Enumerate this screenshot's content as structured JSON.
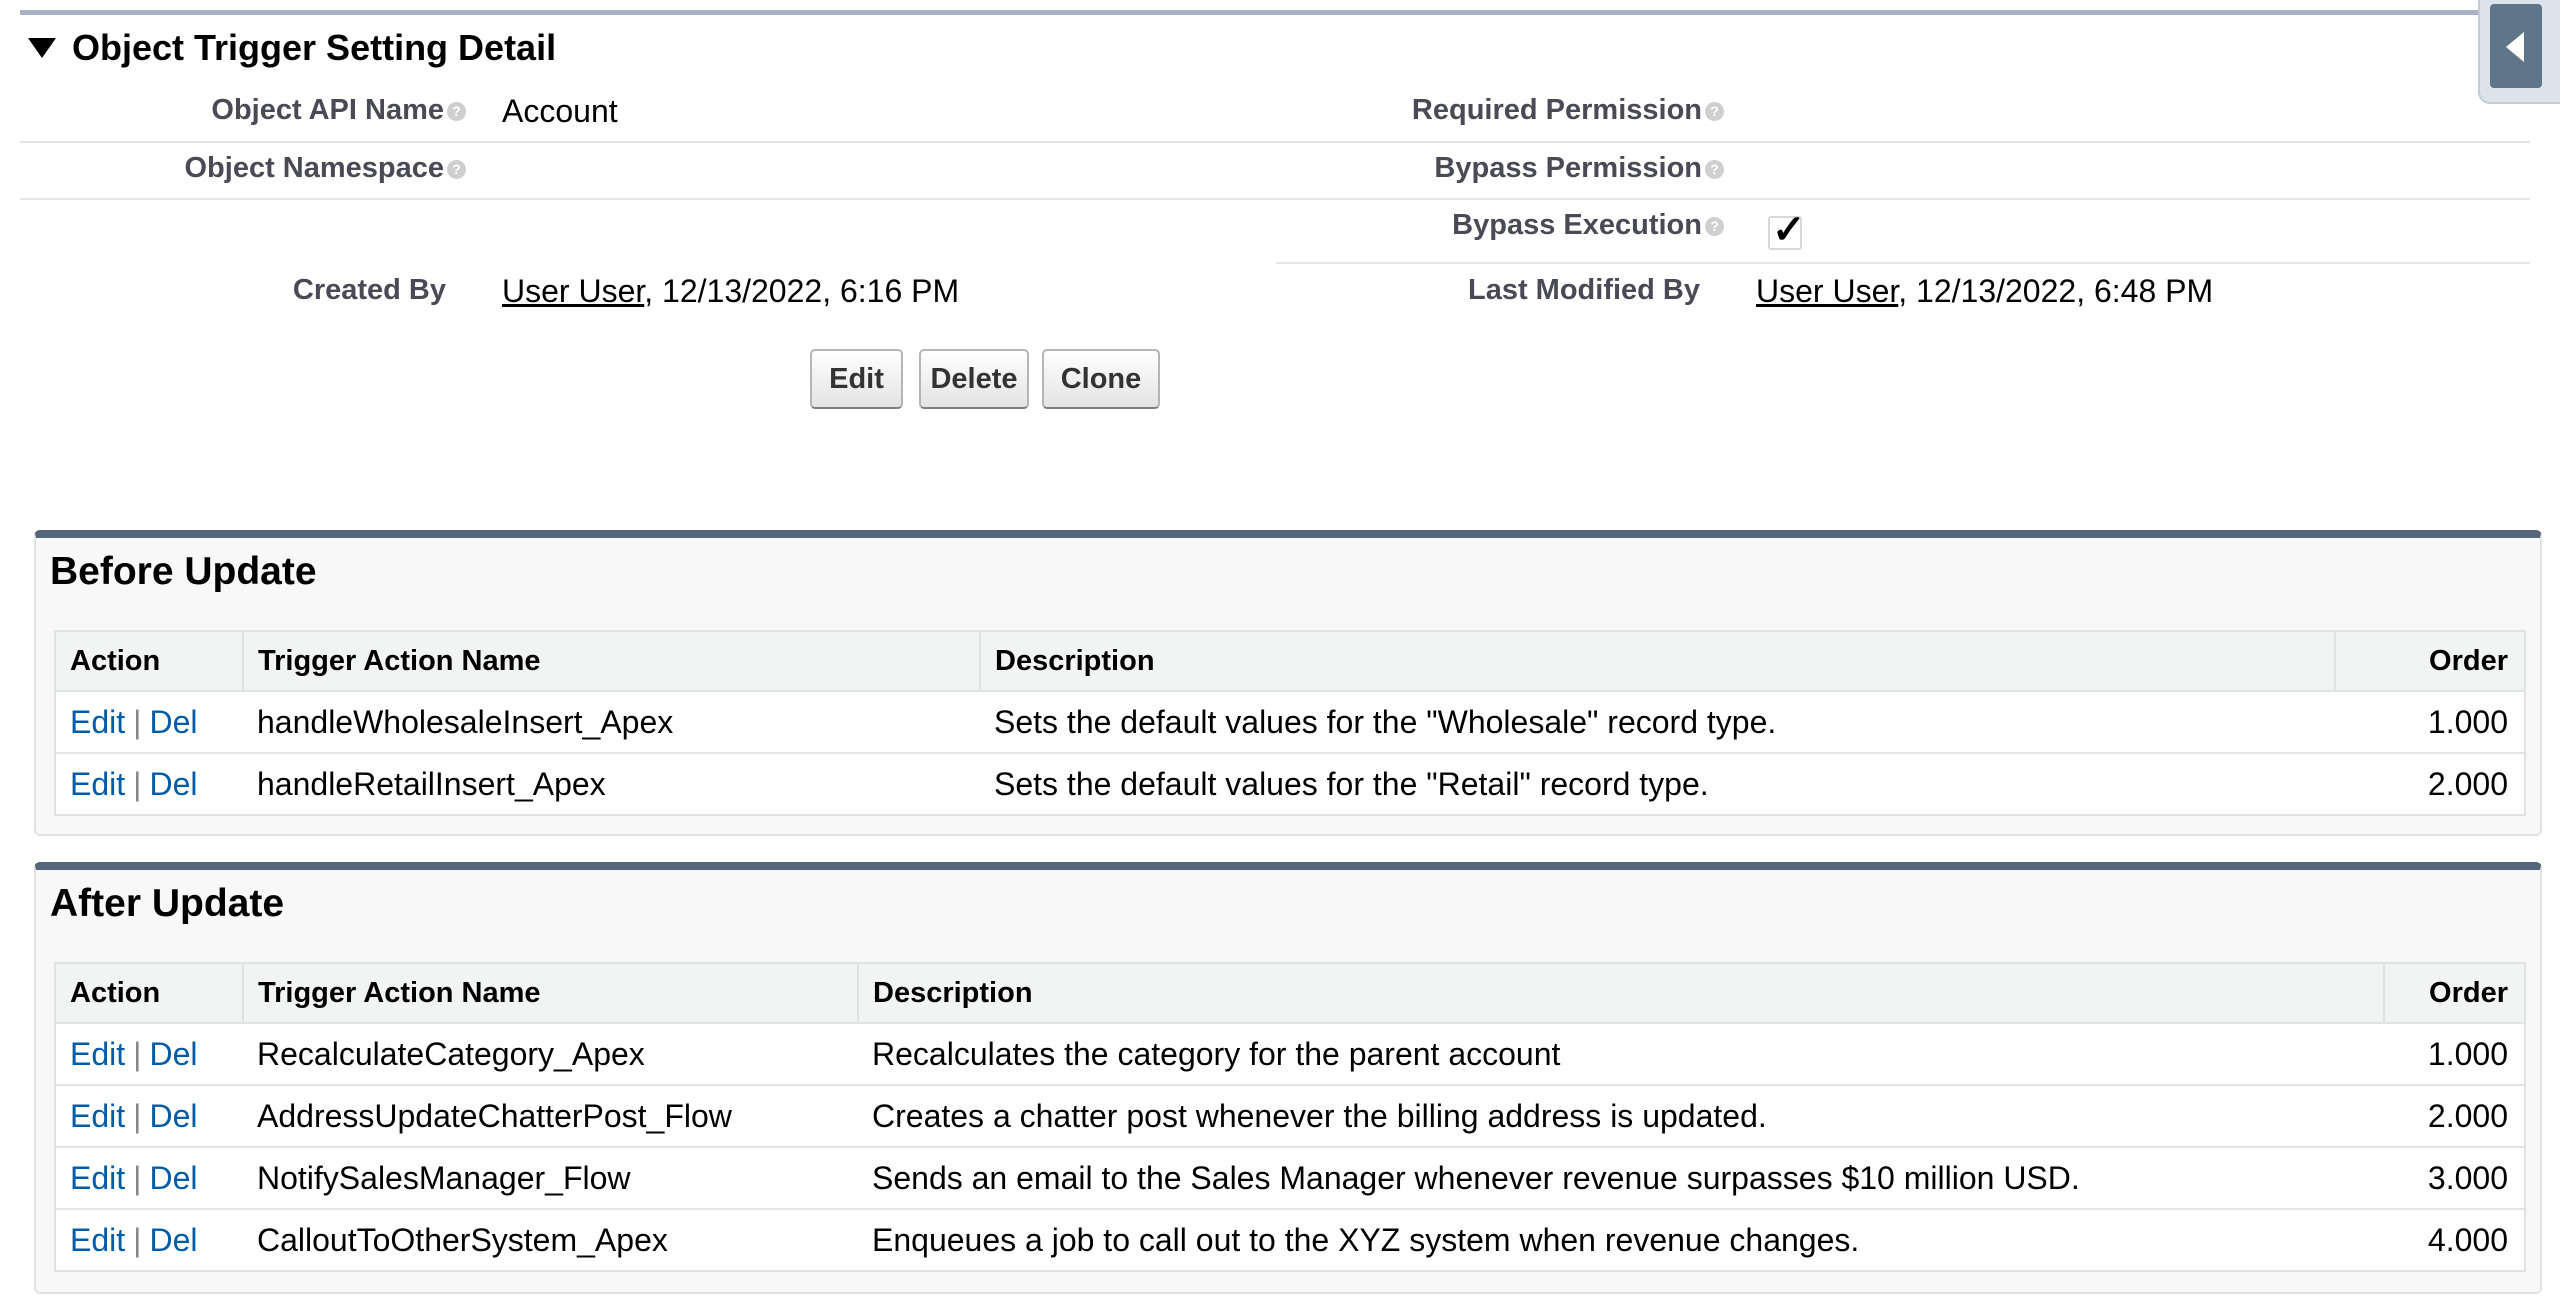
{
  "detail": {
    "title": "Object Trigger Setting Detail",
    "fields": {
      "object_api_name": {
        "label": "Object API Name",
        "value": "Account"
      },
      "required_permission": {
        "label": "Required Permission",
        "value": ""
      },
      "object_namespace": {
        "label": "Object Namespace",
        "value": ""
      },
      "bypass_permission": {
        "label": "Bypass Permission",
        "value": ""
      },
      "bypass_execution": {
        "label": "Bypass Execution",
        "checked": true,
        "check_glyph": "✓"
      },
      "created_by": {
        "label": "Created By",
        "user": "User User",
        "date": ", 12/13/2022, 6:16 PM"
      },
      "last_modified_by": {
        "label": "Last Modified By",
        "user": "User User",
        "date": ", 12/13/2022, 6:48 PM"
      }
    },
    "help_glyph": "?",
    "buttons": {
      "edit": "Edit",
      "delete": "Delete",
      "clone": "Clone"
    }
  },
  "before_update": {
    "title": "Before Update",
    "columns": [
      "Action",
      "Trigger Action Name",
      "Description",
      "Order"
    ],
    "rows": [
      {
        "edit": "Edit",
        "sep": "|",
        "del": "Del",
        "name": "handleWholesaleInsert_Apex",
        "description": "Sets the default values for the \"Wholesale\" record type.",
        "order": "1.000"
      },
      {
        "edit": "Edit",
        "sep": "|",
        "del": "Del",
        "name": "handleRetailInsert_Apex",
        "description": "Sets the default values for the \"Retail\" record type.",
        "order": "2.000"
      }
    ]
  },
  "after_update": {
    "title": "After Update",
    "columns": [
      "Action",
      "Trigger Action Name",
      "Description",
      "Order"
    ],
    "rows": [
      {
        "edit": "Edit",
        "sep": "|",
        "del": "Del",
        "name": "RecalculateCategory_Apex",
        "description": "Recalculates the category for the parent account",
        "order": "1.000"
      },
      {
        "edit": "Edit",
        "sep": "|",
        "del": "Del",
        "name": "AddressUpdateChatterPost_Flow",
        "description": "Creates a chatter post whenever the billing address is updated.",
        "order": "2.000"
      },
      {
        "edit": "Edit",
        "sep": "|",
        "del": "Del",
        "name": "NotifySalesManager_Flow",
        "description": "Sends an email to the Sales Manager whenever revenue surpasses $10 million USD.",
        "order": "3.000"
      },
      {
        "edit": "Edit",
        "sep": "|",
        "del": "Del",
        "name": "CalloutToOtherSystem_Apex",
        "description": "Enqueues a job to call out to the XYZ system when revenue changes.",
        "order": "4.000"
      }
    ]
  },
  "colors": {
    "link": "#015ba7",
    "label": "#4a4a56",
    "list_header_bar": "#56667a",
    "sidebar_tab": "#5f7589"
  },
  "icons": {
    "collapse": "triangle-down-icon",
    "help": "help-icon",
    "sidebar_toggle": "chevron-left-icon"
  }
}
